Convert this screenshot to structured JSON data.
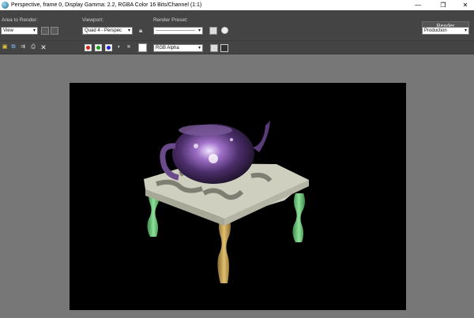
{
  "window": {
    "title": "Perspective, frame 0, Display Gamma: 2.2, RGBA Color 16 Bits/Channel (1:1)",
    "minimize_symbol": "—",
    "restore_symbol": "❐",
    "close_symbol": "✕"
  },
  "toolbar": {
    "area_label": "Area to Render:",
    "area_value": "View",
    "viewport_label": "Viewport:",
    "viewport_value": "Quad 4 - Perspec",
    "preset_label": "Render Preset:",
    "preset_value": "-------------------------",
    "render_button": "Render",
    "production_value": "Production",
    "channel_value": "RGB Alpha"
  },
  "colors": {
    "red_channel": "#e02020",
    "green_channel": "#18a018",
    "blue_channel": "#2020e0",
    "frame_background": "#000000",
    "viewport_background": "#777777"
  },
  "icons": [
    "app-icon",
    "region-icon",
    "lock-icon",
    "environment-icon",
    "settings-icon",
    "save-icon",
    "copy-icon",
    "clone-icon",
    "print-icon",
    "clear-icon",
    "mono-icon",
    "alpha-toggle-icon",
    "display-toggle-icon",
    "chevron-down-icon"
  ]
}
